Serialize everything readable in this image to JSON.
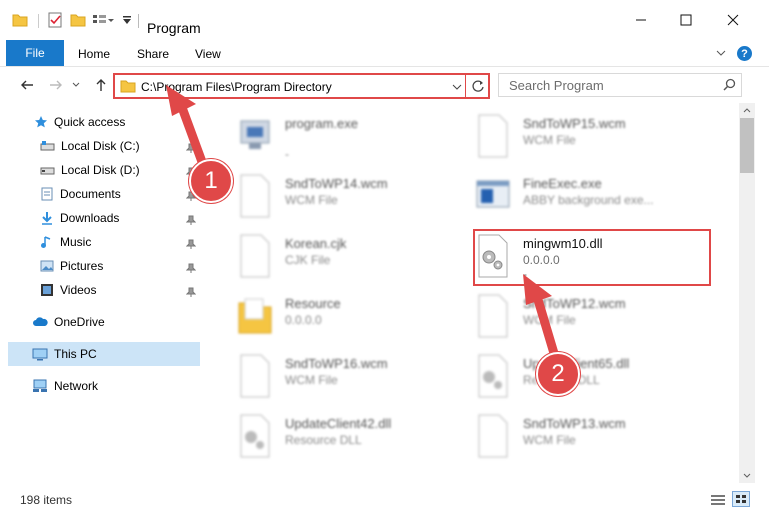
{
  "window": {
    "title": "Program",
    "minimize_icon": "minimize-icon",
    "maximize_icon": "maximize-icon",
    "close_icon": "close-icon"
  },
  "ribbon": {
    "tabs": [
      {
        "label": "File"
      },
      {
        "label": "Home"
      },
      {
        "label": "Share"
      },
      {
        "label": "View"
      }
    ],
    "help_icon": "?"
  },
  "address_bar": {
    "path": "C:\\Program Files\\Program Directory",
    "search_placeholder": "Search Program"
  },
  "navigation": {
    "quick_access": "Quick access",
    "items": [
      {
        "label": "Local Disk (C:)"
      },
      {
        "label": "Local Disk (D:)"
      },
      {
        "label": "Documents"
      },
      {
        "label": "Downloads"
      },
      {
        "label": "Music"
      },
      {
        "label": "Pictures"
      },
      {
        "label": "Videos"
      }
    ],
    "onedrive": "OneDrive",
    "this_pc": "This PC",
    "network": "Network"
  },
  "files": [
    {
      "name": "program.exe",
      "sub": "",
      "extra": "-"
    },
    {
      "name": "SndToWP15.wcm",
      "sub": "WCM File"
    },
    {
      "name": "SndToWP14.wcm",
      "sub": "WCM File"
    },
    {
      "name": "FineExec.exe",
      "sub": "ABBY background exe..."
    },
    {
      "name": "Korean.cjk",
      "sub": "CJK File"
    },
    {
      "name": "mingwm10.dll",
      "sub": "0.0.0.0",
      "extra": "-"
    },
    {
      "name": "Resource",
      "sub": "0.0.0.0"
    },
    {
      "name": "SndToWP12.wcm",
      "sub": "WCM File"
    },
    {
      "name": "SndToWP16.wcm",
      "sub": "WCM File"
    },
    {
      "name": "UpdateClient65.dll",
      "sub": "Resource DLL"
    },
    {
      "name": "UpdateClient42.dll",
      "sub": "Resource DLL"
    },
    {
      "name": "SndToWP13.wcm",
      "sub": "WCM File"
    }
  ],
  "status_bar": {
    "item_count": "198 items"
  },
  "annotations": {
    "badge1": "1",
    "badge2": "2",
    "highlight_color": "#e04848"
  }
}
